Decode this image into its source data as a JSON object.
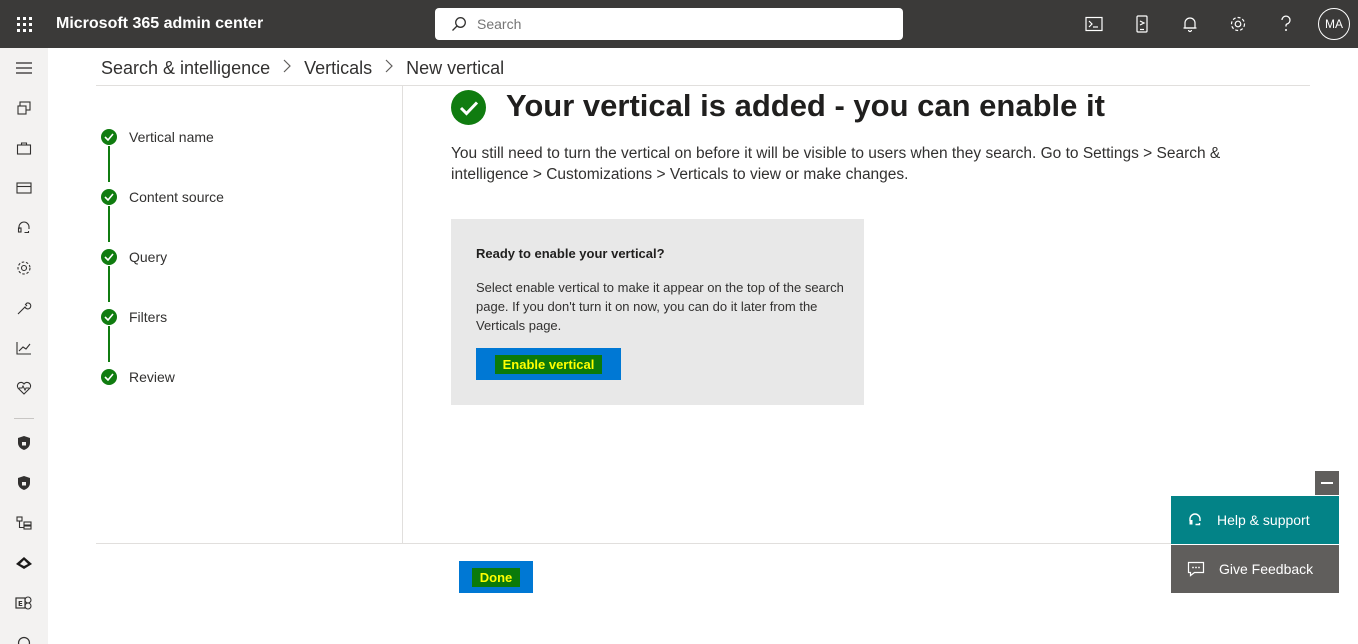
{
  "app": {
    "title": "Microsoft 365 admin center"
  },
  "search": {
    "placeholder": "Search"
  },
  "user": {
    "initials": "MA"
  },
  "top_icons": [
    "terminal-icon",
    "mobile-device-icon",
    "bell-icon",
    "gear-icon",
    "question-icon"
  ],
  "breadcrumb": {
    "items": [
      "Search & intelligence",
      "Verticals"
    ],
    "current": "New vertical"
  },
  "steps": [
    {
      "label": "Vertical name",
      "status": "complete"
    },
    {
      "label": "Content source",
      "status": "complete"
    },
    {
      "label": "Query",
      "status": "complete"
    },
    {
      "label": "Filters",
      "status": "complete"
    },
    {
      "label": "Review",
      "status": "complete"
    }
  ],
  "main": {
    "title": "Your vertical is added - you can enable it",
    "description": "You still need to turn the vertical on before it will be visible to users when they search. Go to Settings > Search & intelligence > Customizations > Verticals to view or make changes."
  },
  "card": {
    "title": "Ready to enable your vertical?",
    "text": "Select enable vertical to make it appear on the top of the search page. If you don't turn it on now, you can do it later from the Verticals page.",
    "button_label": "Enable vertical"
  },
  "footer": {
    "done_label": "Done"
  },
  "help_panel": {
    "help_label": "Help & support",
    "feedback_label": "Give Feedback"
  },
  "colors": {
    "topbar": "#3b3a39",
    "accent": "#0078d4",
    "success": "#107c10",
    "help": "#038387",
    "highlight_bg": "#0b7a0b",
    "highlight_text": "#ffff00"
  }
}
